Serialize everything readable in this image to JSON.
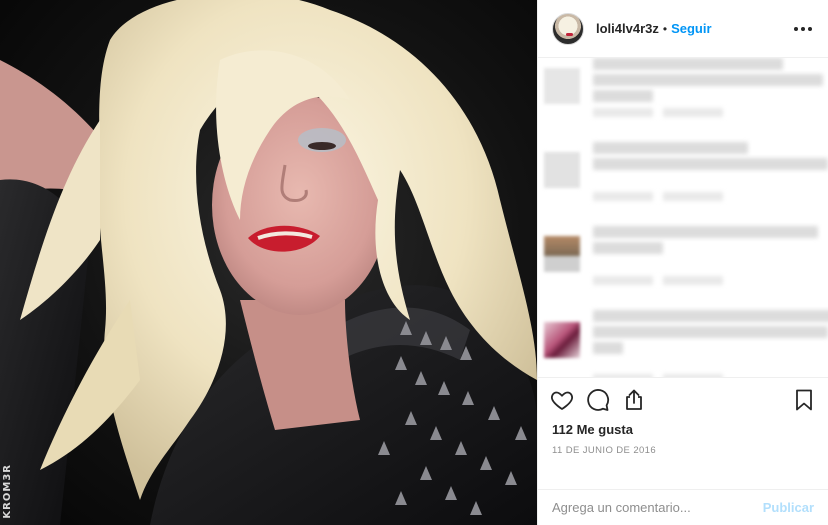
{
  "post": {
    "username": "loli4lv4r3z",
    "separator": "•",
    "follow_label": "Seguir",
    "more_icon": "more-horizontal-icon"
  },
  "photo": {
    "watermark": "KROM3R",
    "description_icon": "photo"
  },
  "comments_visible": 4,
  "actions": {
    "like_icon": "heart-icon",
    "comment_icon": "comment-bubble-icon",
    "share_icon": "share-icon",
    "save_icon": "bookmark-icon",
    "likes_text": "112 Me gusta",
    "date": "11 DE JUNIO DE 2016"
  },
  "comment_box": {
    "placeholder": "Agrega un comentario...",
    "publish_label": "Publicar"
  },
  "colors": {
    "accent": "#0095f6",
    "publish_disabled": "#b2dffc",
    "muted": "#8e8e8e"
  }
}
